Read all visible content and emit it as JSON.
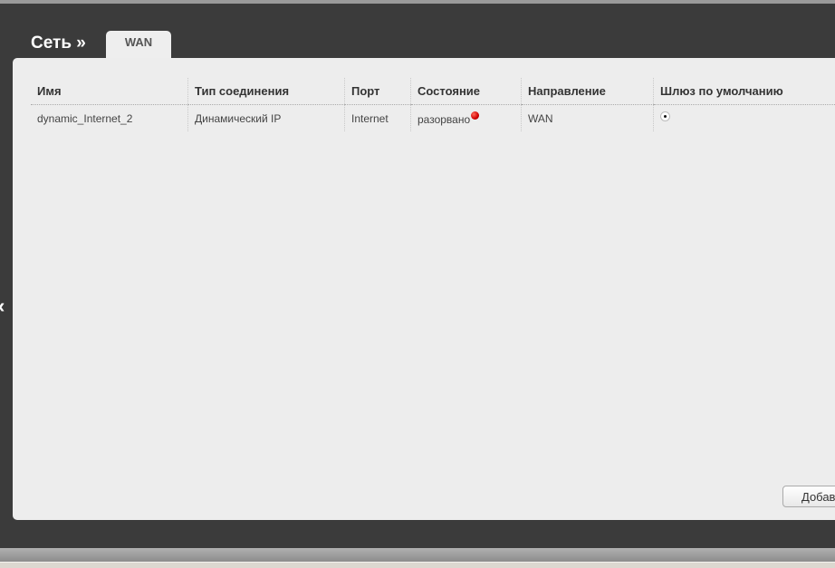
{
  "header": {
    "title": "Сеть »",
    "tab": "WAN"
  },
  "table": {
    "columns": [
      "Имя",
      "Тип соединения",
      "Порт",
      "Состояние",
      "Направление",
      "Шлюз по умолчанию"
    ],
    "rows": [
      {
        "name": "dynamic_Internet_2",
        "type": "Динамический IP",
        "port": "Internet",
        "status": "разорвано",
        "direction": "WAN",
        "default_gateway": true
      }
    ]
  },
  "buttons": {
    "add": "Добавить",
    "back": "‹"
  },
  "colors": {
    "status_disconnected": "#d00000"
  }
}
